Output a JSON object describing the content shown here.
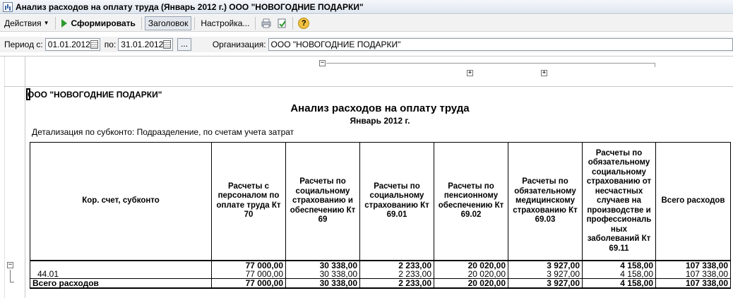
{
  "window": {
    "title": "Анализ расходов на оплату труда (Январь 2012 г.) ООО \"НОВОГОДНИЕ ПОДАРКИ\""
  },
  "toolbar": {
    "actions_label": "Действия",
    "generate_label": "Сформировать",
    "header_label": "Заголовок",
    "settings_label": "Настройка...",
    "help_label": "?"
  },
  "filters": {
    "period_from_label": "Период с:",
    "period_from": "01.01.2012",
    "period_to_label": "по:",
    "period_to": "31.01.2012",
    "more_label": "...",
    "org_label": "Организация:",
    "org_value": "ООО \"НОВОГОДНИЕ ПОДАРКИ\""
  },
  "report": {
    "org_name": "ООО \"НОВОГОДНИЕ ПОДАРКИ\"",
    "title": "Анализ расходов на оплату труда",
    "subtitle": "Январь 2012 г.",
    "detail": "Детализация по субконто: Подразделение, по счетам учета затрат",
    "columns": [
      "Кор. счет, субконто",
      "Расчеты с персоналом по оплате труда Кт 70",
      "Расчеты по социальному страхованию и обеспечению Кт 69",
      "Расчеты по социальному страхованию Кт 69.01",
      "Расчеты по пенсионному обеспечению Кт 69.02",
      "Расчеты по обязательному медицинскому страхованию Кт 69.03",
      "Расчеты по обязательному социальному страхованию от несчастных случаев на производстве и профессиональ ных заболеваний Кт 69.11",
      "Всего расходов"
    ],
    "rows": [
      {
        "label": "",
        "values": [
          "77 000,00",
          "30 338,00",
          "2 233,00",
          "20 020,00",
          "3 927,00",
          "4 158,00",
          "107 338,00"
        ]
      },
      {
        "label": "44.01",
        "values": [
          "77 000,00",
          "30 338,00",
          "2 233,00",
          "20 020,00",
          "3 927,00",
          "4 158,00",
          "107 338,00"
        ]
      },
      {
        "label": "Всего расходов",
        "values": [
          "77 000,00",
          "30 338,00",
          "2 233,00",
          "20 020,00",
          "3 927,00",
          "4 158,00",
          "107 338,00"
        ]
      }
    ]
  },
  "icons": {
    "app": "report-window-icon",
    "calendar": "calendar-icon",
    "play": "play-icon"
  }
}
